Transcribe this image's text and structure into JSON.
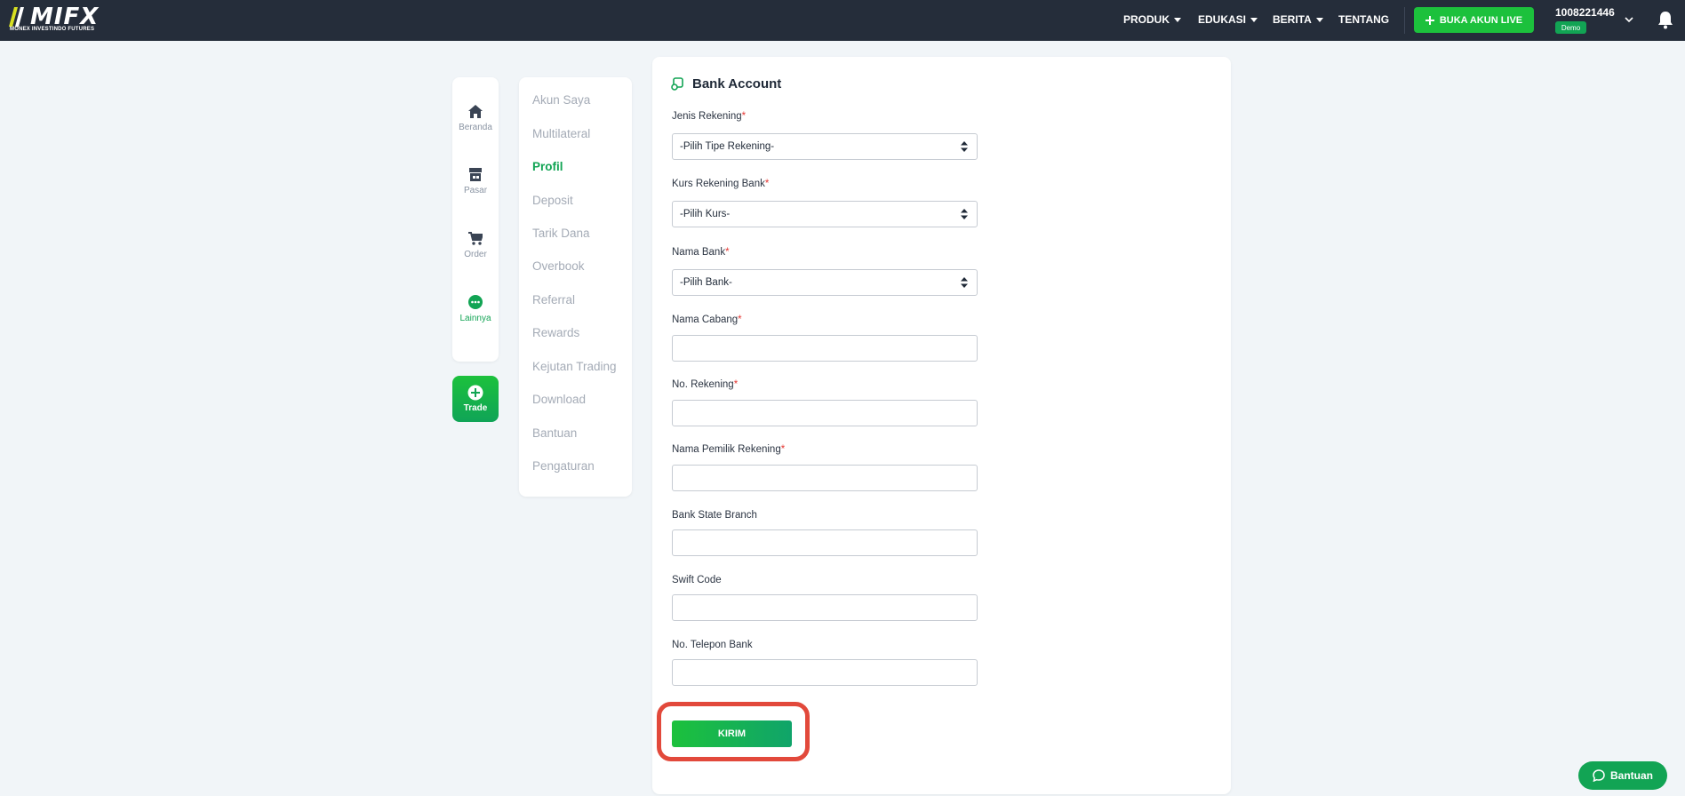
{
  "header": {
    "logo": {
      "wordmark": "MIFX",
      "tagline": "MONEX INVESTINDO FUTURES"
    },
    "nav": [
      {
        "label": "PRODUK",
        "dropdown": true
      },
      {
        "label": "EDUKASI",
        "dropdown": true
      },
      {
        "label": "BERITA",
        "dropdown": true
      },
      {
        "label": "TENTANG",
        "dropdown": false
      }
    ],
    "cta_label": "BUKA AKUN LIVE",
    "account_number": "1008221446",
    "account_badge": "Demo",
    "icons": {
      "account_menu": "chevron-down-icon",
      "notifications": "bell-icon",
      "cta": "plus-icon"
    }
  },
  "sidebar": {
    "items": [
      {
        "label": "Beranda",
        "icon": "home-icon",
        "active": false
      },
      {
        "label": "Pasar",
        "icon": "store-icon",
        "active": false
      },
      {
        "label": "Order",
        "icon": "cart-icon",
        "active": false
      },
      {
        "label": "Lainnya",
        "icon": "more-icon",
        "active": true
      }
    ],
    "trade_label": "Trade",
    "trade_icon": "plus-circle-icon"
  },
  "menu": {
    "items": [
      "Akun Saya",
      "Multilateral",
      "Profil",
      "Deposit",
      "Tarik Dana",
      "Overbook",
      "Referral",
      "Rewards",
      "Kejutan Trading",
      "Download",
      "Bantuan",
      "Pengaturan"
    ],
    "active": "Profil"
  },
  "form": {
    "title": "Bank Account",
    "title_icon": "bank-icon",
    "fields": [
      {
        "label": "Jenis Rekening",
        "required": true,
        "type": "select",
        "value": "-Pilih Tipe Rekening-"
      },
      {
        "label": "Kurs Rekening Bank",
        "required": true,
        "type": "select",
        "value": "-Pilih Kurs-"
      },
      {
        "label": "Nama Bank",
        "required": true,
        "type": "select",
        "value": "-Pilih Bank-"
      },
      {
        "label": "Nama Cabang",
        "required": true,
        "type": "text",
        "value": ""
      },
      {
        "label": "No. Rekening",
        "required": true,
        "type": "text",
        "value": ""
      },
      {
        "label": "Nama Pemilik Rekening",
        "required": true,
        "type": "text",
        "value": ""
      },
      {
        "label": "Bank State Branch",
        "required": false,
        "type": "text",
        "value": ""
      },
      {
        "label": "Swift Code",
        "required": false,
        "type": "text",
        "value": ""
      },
      {
        "label": "No. Telepon Bank",
        "required": false,
        "type": "text",
        "value": ""
      }
    ],
    "submit_label": "KIRIM",
    "required_mark": "*"
  },
  "help_button": {
    "label": "Bantuan",
    "icon": "chat-icon"
  },
  "colors": {
    "topbar": "#252d3a",
    "accent_green": "#12a454",
    "cta_green": "#1cc13c",
    "page_bg": "#f1f5f8",
    "highlight_ring": "#e2493b",
    "required": "#e53935"
  }
}
